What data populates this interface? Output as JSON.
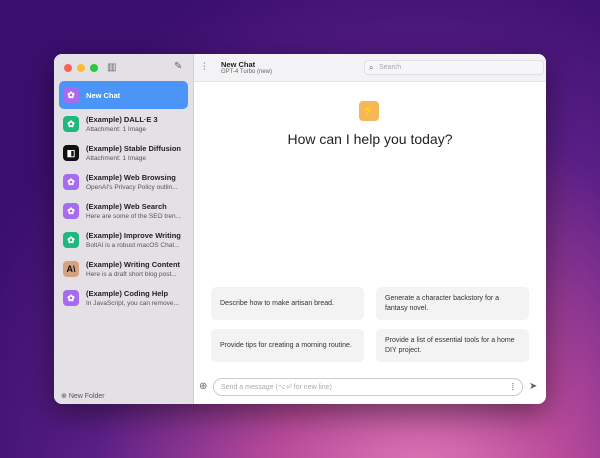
{
  "sidebar": {
    "items": [
      {
        "title": "New Chat",
        "subtitle": "",
        "icon": "openai-icon",
        "color": "#a66bf0",
        "selected": true
      },
      {
        "title": "(Example) DALL·E 3",
        "subtitle": "Attachment: 1 Image",
        "icon": "openai-icon",
        "color": "#1fb980"
      },
      {
        "title": "(Example) Stable Diffusion",
        "subtitle": "Attachment: 1 Image",
        "icon": "stability-icon",
        "color": "#111111"
      },
      {
        "title": "(Example) Web Browsing",
        "subtitle": "OpenAI's Privacy Policy outlin...",
        "icon": "openai-icon",
        "color": "#a66bf0"
      },
      {
        "title": "(Example) Web Search",
        "subtitle": "Here are some of the SEO tren...",
        "icon": "openai-icon",
        "color": "#a66bf0"
      },
      {
        "title": "(Example) Improve Writing",
        "subtitle": "BoltAI is a robust macOS Chat...",
        "icon": "openai-icon",
        "color": "#1fb980"
      },
      {
        "title": "(Example) Writing Content",
        "subtitle": "Here is a draft short blog post...",
        "icon": "anthropic-icon",
        "color": "#d4a27f"
      },
      {
        "title": "(Example) Coding Help",
        "subtitle": "In JavaScript, you can remove...",
        "icon": "openai-icon",
        "color": "#a66bf0"
      }
    ],
    "new_folder": "New Folder"
  },
  "header": {
    "title": "New Chat",
    "model": "GPT-4 Turbo (new)",
    "search_placeholder": "Search"
  },
  "main": {
    "greeting": "How can I help you today?",
    "suggestions": [
      "Describe how to make artisan bread.",
      "Generate a character backstory for a fantasy novel.",
      "Provide tips for creating a morning routine.",
      "Provide a list of essential tools for a home DIY project."
    ],
    "input_placeholder": "Send a message (⌥⏎ for new line)"
  }
}
